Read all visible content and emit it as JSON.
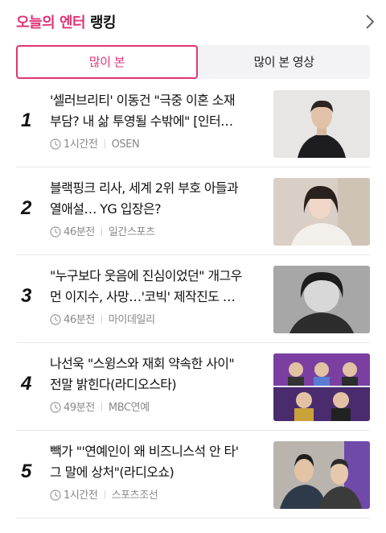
{
  "header": {
    "title_accent": "오늘의 엔터",
    "title_plain": "랭킹",
    "more_icon": "chevron-right-icon"
  },
  "tabs": [
    {
      "label": "많이 본",
      "selected": true
    },
    {
      "label": "많이 본 영상",
      "selected": false
    }
  ],
  "colors": {
    "accent": "#e0357a",
    "text": "#111111",
    "meta": "#888888",
    "divider": "#e9e9ec"
  },
  "items": [
    {
      "rank": "1",
      "line1": "'셀러브리티' 이동건 \"극중 이혼 소재",
      "line2": "부담? 내 삶 투영될 수밖에\" [인터…",
      "time": "1시간전",
      "source": "OSEN",
      "thumb_icon": "actor-photo"
    },
    {
      "rank": "2",
      "line1": "블랙핑크 리사, 세계 2위 부호 아들과",
      "line2": "열애설… YG 입장은?",
      "time": "46분전",
      "source": "일간스포츠",
      "thumb_icon": "singer-photo"
    },
    {
      "rank": "3",
      "line1": "\"누구보다 웃음에 진심이었던\" 개그우",
      "line2": "먼 이지수, 사망…'코빅' 제작진도 …",
      "time": "46분전",
      "source": "마이데일리",
      "thumb_icon": "comedian-photo"
    },
    {
      "rank": "4",
      "line1": "나선욱 \"스윙스와 재회 약속한 사이\"",
      "line2": "전말 밝힌다(라디오스타)",
      "time": "49분전",
      "source": "MBC연예",
      "thumb_icon": "tv-show-photo"
    },
    {
      "rank": "5",
      "line1": "빽가 \"'연예인이 왜 비즈니스석 안 타'",
      "line2": "그 말에 상처\"(라디오쇼)",
      "time": "1시간전",
      "source": "스포츠조선",
      "thumb_icon": "radio-photo"
    }
  ]
}
